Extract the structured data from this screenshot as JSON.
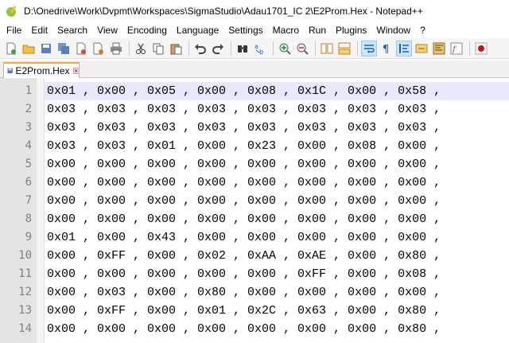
{
  "window": {
    "title": "D:\\Onedrive\\Work\\Dvpmt\\Workspaces\\SigmaStudio\\Adau1701_IC 2\\E2Prom.Hex - Notepad++"
  },
  "menu": [
    "File",
    "Edit",
    "Search",
    "View",
    "Encoding",
    "Language",
    "Settings",
    "Macro",
    "Run",
    "Plugins",
    "Window",
    "?"
  ],
  "toolbar": {
    "buttons": [
      "new-file",
      "open-file",
      "save",
      "save-all",
      "close",
      "close-all",
      "print",
      "cut",
      "copy",
      "paste",
      "undo",
      "redo",
      "find",
      "replace",
      "zoom-in",
      "zoom-out",
      "sync-vertical",
      "sync-horizontal",
      "word-wrap",
      "show-all-chars",
      "indent-guide",
      "user-define",
      "doc-map",
      "function-list",
      "record-macro"
    ]
  },
  "tab": {
    "label": "E2Prom.Hex"
  },
  "editor": {
    "lines": [
      {
        "num": "1",
        "text": "0x01 , 0x00 , 0x05 , 0x00 , 0x08 , 0x1C , 0x00 , 0x58 ,"
      },
      {
        "num": "2",
        "text": "0x03 , 0x03 , 0x03 , 0x03 , 0x03 , 0x03 , 0x03 , 0x03 ,"
      },
      {
        "num": "3",
        "text": "0x03 , 0x03 , 0x03 , 0x03 , 0x03 , 0x03 , 0x03 , 0x03 ,"
      },
      {
        "num": "4",
        "text": "0x03 , 0x03 , 0x01 , 0x00 , 0x23 , 0x00 , 0x08 , 0x00 ,"
      },
      {
        "num": "5",
        "text": "0x00 , 0x00 , 0x00 , 0x00 , 0x00 , 0x00 , 0x00 , 0x00 ,"
      },
      {
        "num": "6",
        "text": "0x00 , 0x00 , 0x00 , 0x00 , 0x00 , 0x00 , 0x00 , 0x00 ,"
      },
      {
        "num": "7",
        "text": "0x00 , 0x00 , 0x00 , 0x00 , 0x00 , 0x00 , 0x00 , 0x00 ,"
      },
      {
        "num": "8",
        "text": "0x00 , 0x00 , 0x00 , 0x00 , 0x00 , 0x00 , 0x00 , 0x00 ,"
      },
      {
        "num": "9",
        "text": "0x01 , 0x00 , 0x43 , 0x00 , 0x00 , 0x00 , 0x00 , 0x00 ,"
      },
      {
        "num": "10",
        "text": "0x00 , 0xFF , 0x00 , 0x02 , 0xAA , 0xAE , 0x00 , 0x80 ,"
      },
      {
        "num": "11",
        "text": "0x00 , 0x00 , 0x00 , 0x00 , 0x00 , 0xFF , 0x00 , 0x08 ,"
      },
      {
        "num": "12",
        "text": "0x00 , 0x03 , 0x00 , 0x80 , 0x00 , 0x00 , 0x00 , 0x00 ,"
      },
      {
        "num": "13",
        "text": "0x00 , 0xFF , 0x00 , 0x01 , 0x2C , 0x63 , 0x00 , 0x80 ,"
      },
      {
        "num": "14",
        "text": "0x00 , 0x00 , 0x00 , 0x00 , 0x00 , 0x00 , 0x00 , 0x80 ,"
      }
    ]
  }
}
